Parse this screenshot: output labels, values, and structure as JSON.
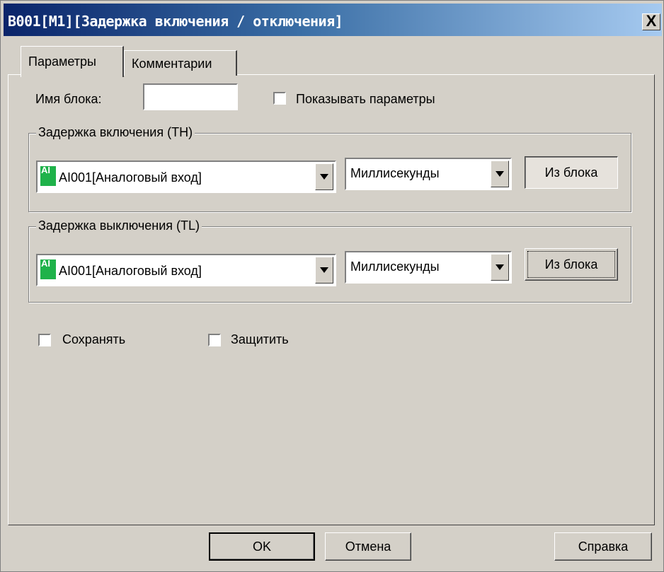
{
  "window": {
    "title": "B001[M1][Задержка включения / отключения]",
    "close": "X"
  },
  "tabs": [
    {
      "label": "Параметры"
    },
    {
      "label": "Комментарии"
    }
  ],
  "params": {
    "block_name_label": "Имя блока:",
    "block_name_value": "",
    "show_params_label": "Показывать параметры",
    "show_params_checked": false
  },
  "group_on": {
    "legend": "Задержка включения (TH)",
    "icon_text": "AI",
    "source": "AI001[Аналоговый вход]",
    "unit": "Миллисекунды",
    "from_block": "Из блока"
  },
  "group_off": {
    "legend": "Задержка выключения (TL)",
    "icon_text": "AI",
    "source": "AI001[Аналоговый вход]",
    "unit": "Миллисекунды",
    "from_block": "Из блока"
  },
  "options": {
    "retain_label": "Сохранять",
    "retain_checked": false,
    "protect_label": "Защитить",
    "protect_checked": false
  },
  "buttons": {
    "ok": "OK",
    "cancel": "Отмена",
    "help": "Справка"
  },
  "colors": {
    "titlebar_start": "#0a246a",
    "titlebar_end": "#a6caf0",
    "dialog_bg": "#d4d0c8",
    "ai_icon": "#1fb24a"
  }
}
